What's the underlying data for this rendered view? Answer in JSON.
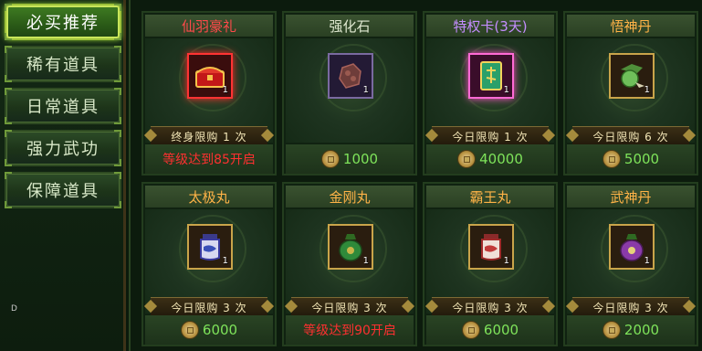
{
  "sidebar": {
    "tabs": [
      {
        "label": "必买推荐",
        "active": true
      },
      {
        "label": "稀有道具",
        "active": false
      },
      {
        "label": "日常道具",
        "active": false
      },
      {
        "label": "强力武功",
        "active": false
      },
      {
        "label": "保障道具",
        "active": false
      }
    ],
    "marker": "D"
  },
  "colors": {
    "title_red": "#ff4a4a",
    "title_light": "#dfe8d0",
    "title_purple": "#c48dff",
    "title_orange": "#ffb347",
    "price_green": "#7ee35a",
    "unlock_red": "#ff3030"
  },
  "items": [
    {
      "name": "仙羽豪礼",
      "title_color": "#ff4a4a",
      "icon": "red-treasure-chest-icon",
      "frame": "red",
      "qty": "1",
      "limit": "终身限购  1  次",
      "footer_type": "unlock",
      "footer": "等级达到85开启"
    },
    {
      "name": "强化石",
      "title_color": "#dfe8d0",
      "icon": "strengthen-stone-icon",
      "frame": "purple",
      "qty": "1",
      "limit": "",
      "footer_type": "price",
      "footer": "1000"
    },
    {
      "name": "特权卡(3天)",
      "title_color": "#c48dff",
      "icon": "privilege-card-icon",
      "frame": "pink",
      "qty": "1",
      "limit": "今日限购  1  次",
      "footer_type": "price",
      "footer": "40000"
    },
    {
      "name": "悟神丹",
      "title_color": "#ffb347",
      "icon": "herb-pill-icon",
      "frame": "gold",
      "qty": "1",
      "limit": "今日限购  6  次",
      "footer_type": "price",
      "footer": "5000"
    },
    {
      "name": "太极丸",
      "title_color": "#ffb347",
      "icon": "blue-jar-icon",
      "frame": "gold",
      "qty": "1",
      "limit": "今日限购  3  次",
      "footer_type": "price",
      "footer": "6000"
    },
    {
      "name": "金刚丸",
      "title_color": "#ffb347",
      "icon": "green-gourd-icon",
      "frame": "gold",
      "qty": "1",
      "limit": "今日限购  3  次",
      "footer_type": "unlock",
      "footer": "等级达到90开启"
    },
    {
      "name": "霸王丸",
      "title_color": "#ffb347",
      "icon": "red-jar-icon",
      "frame": "gold",
      "qty": "1",
      "limit": "今日限购  3  次",
      "footer_type": "price",
      "footer": "6000"
    },
    {
      "name": "武神丹",
      "title_color": "#ffb347",
      "icon": "purple-gourd-icon",
      "frame": "gold",
      "qty": "1",
      "limit": "今日限购  3  次",
      "footer_type": "price",
      "footer": "2000"
    }
  ]
}
